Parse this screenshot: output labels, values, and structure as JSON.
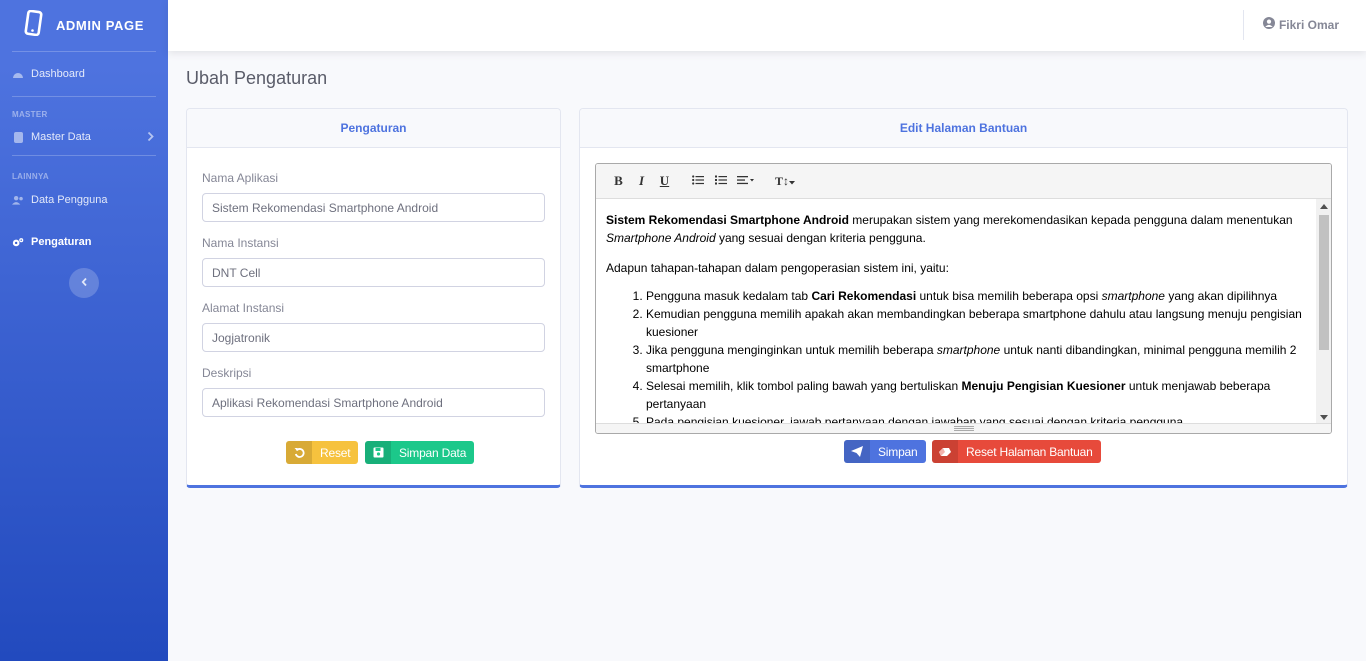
{
  "brand": {
    "title": "ADMIN PAGE"
  },
  "sidebar": {
    "dashboard": "Dashboard",
    "heading_master": "MASTER",
    "master_data": "Master Data",
    "heading_lainnya": "LAINNYA",
    "data_pengguna": "Data Pengguna",
    "pengaturan": "Pengaturan"
  },
  "topbar": {
    "user_name": "Fikri Omar"
  },
  "page": {
    "title": "Ubah Pengaturan"
  },
  "settings_card": {
    "header": "Pengaturan",
    "fields": [
      {
        "label": "Nama Aplikasi",
        "value": "Sistem Rekomendasi Smartphone Android"
      },
      {
        "label": "Nama Instansi",
        "value": "DNT Cell"
      },
      {
        "label": "Alamat Instansi",
        "value": "Jogjatronik"
      },
      {
        "label": "Deskripsi",
        "value": "Aplikasi Rekomendasi Smartphone Android"
      }
    ],
    "reset_label": "Reset",
    "save_label": "Simpan Data"
  },
  "help_card": {
    "header": "Edit Halaman Bantuan",
    "toolbar": {
      "bold": "B",
      "italic": "I",
      "underline": "U",
      "font_size": "T↕"
    },
    "content": {
      "p1_bold": "Sistem Rekomendasi Smartphone Android",
      "p1_rest": " merupakan sistem yang merekomendasikan kepada pengguna dalam menentukan ",
      "p1_italic": "Smartphone Android",
      "p1_end": " yang sesuai dengan kriteria pengguna.",
      "p2": "Adapun tahapan-tahapan dalam pengoperasian sistem ini, yaitu:",
      "li1_a": "Pengguna masuk kedalam tab ",
      "li1_b": "Cari Rekomendasi",
      "li1_c": " untuk bisa memilih beberapa opsi ",
      "li1_d": "smartphone",
      "li1_e": " yang akan dipilihnya",
      "li2": "Kemudian pengguna memilih apakah akan membandingkan beberapa smartphone dahulu atau langsung menuju pengisian kuesioner",
      "li3_a": "Jika pengguna menginginkan untuk memilih beberapa ",
      "li3_b": "smartphone",
      "li3_c": " untuk nanti dibandingkan, minimal pengguna memilih 2 smartphone",
      "li4_a": "Selesai memilih, klik tombol paling bawah yang bertuliskan ",
      "li4_b": "Menuju Pengisian Kuesioner",
      "li4_c": " untuk menjawab beberapa pertanyaan",
      "li5": "Pada pengisian kuesioner, jawab pertanyaan dengan jawaban yang sesuai dengan kriteria pengguna"
    },
    "save_label": "Simpan",
    "reset_label": "Reset Halaman Bantuan"
  },
  "colors": {
    "primary": "#4e73df",
    "warning": "#f6c23e",
    "success": "#1cc88a",
    "danger": "#e74a3b"
  }
}
